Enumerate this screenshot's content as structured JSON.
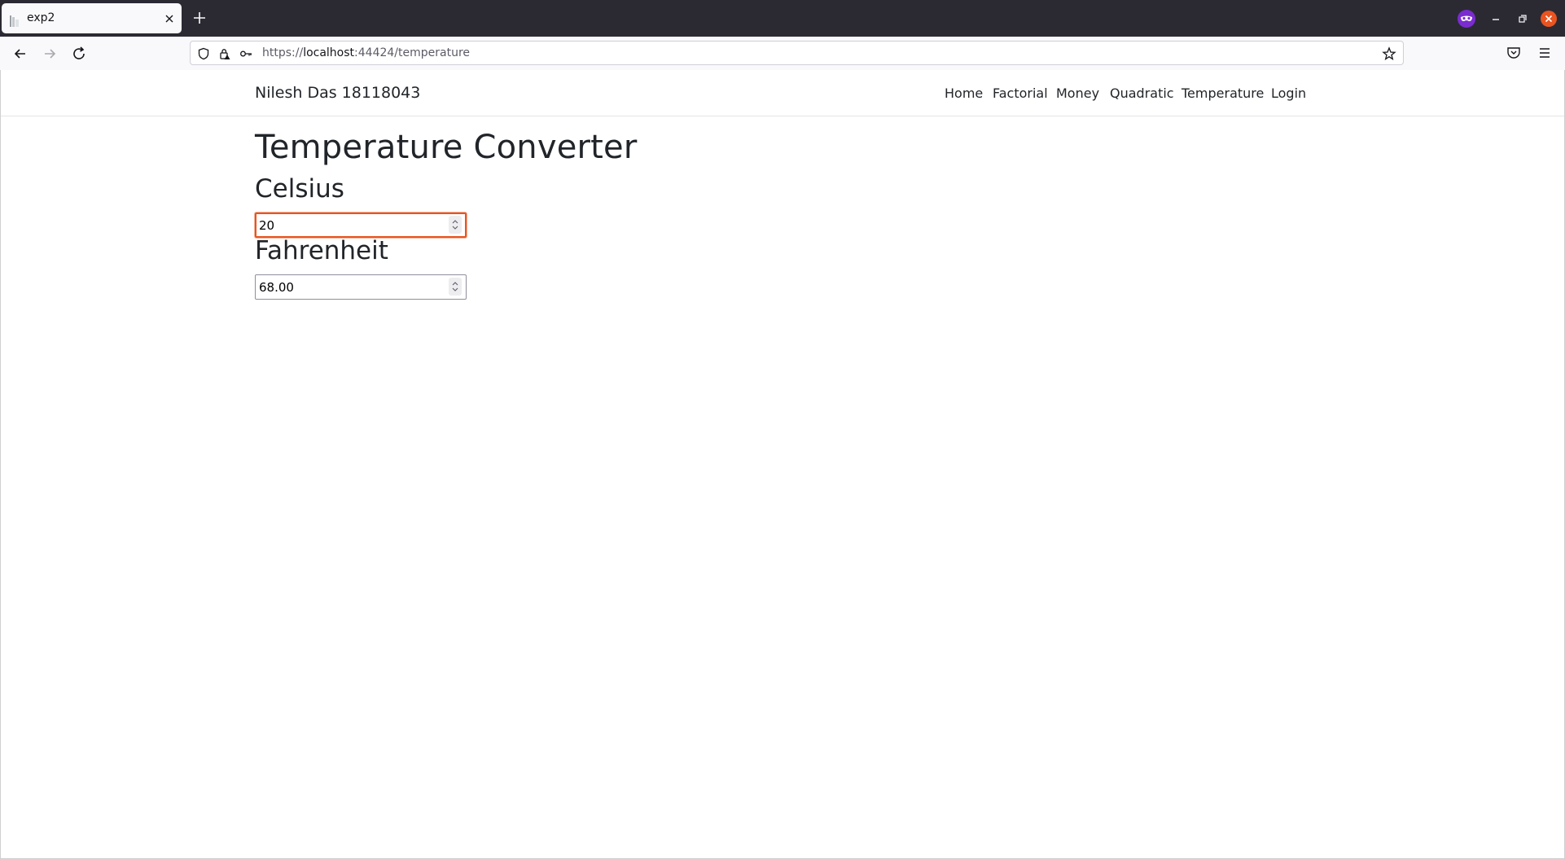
{
  "browser": {
    "tab_title": "exp2",
    "url_scheme": "https://",
    "url_host": "localhost",
    "url_rest": ":44424/temperature"
  },
  "site": {
    "brand": "Nilesh Das 18118043",
    "nav": [
      "Home",
      "Factorial",
      "Money",
      "Quadratic",
      "Temperature",
      "Login"
    ]
  },
  "main": {
    "title": "Temperature Converter",
    "celsius_label": "Celsius",
    "celsius_value": "20",
    "fahrenheit_label": "Fahrenheit",
    "fahrenheit_value": "68.00"
  },
  "colors": {
    "focus_accent": "#e95420",
    "tabbar": "#2b2a33"
  }
}
